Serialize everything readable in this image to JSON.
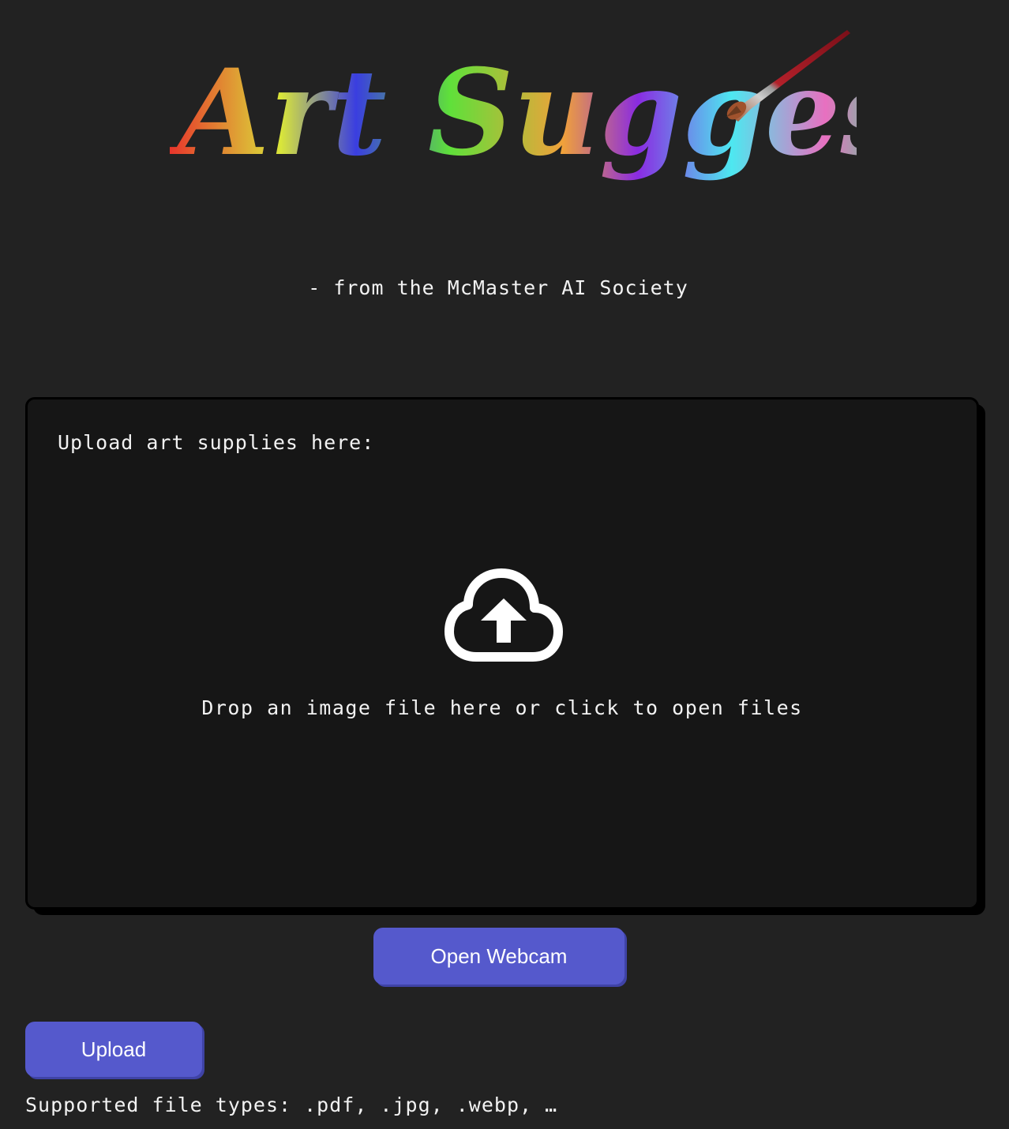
{
  "header": {
    "logo_text": "Art Suggester",
    "logo_icon": "paintbrush-icon",
    "subtitle": "- from the McMaster AI Society"
  },
  "dropzone": {
    "label": "Upload art supplies here:",
    "icon": "cloud-upload-icon",
    "hint": "Drop an image file here or click to open files"
  },
  "buttons": {
    "webcam_label": "Open Webcam",
    "upload_label": "Upload"
  },
  "footer": {
    "supported_types": "Supported file types: .pdf, .jpg, .webp, …"
  },
  "colors": {
    "background": "#222222",
    "dropzone_bg": "#161616",
    "button": "#5559cc",
    "text": "#f2f2f2"
  }
}
